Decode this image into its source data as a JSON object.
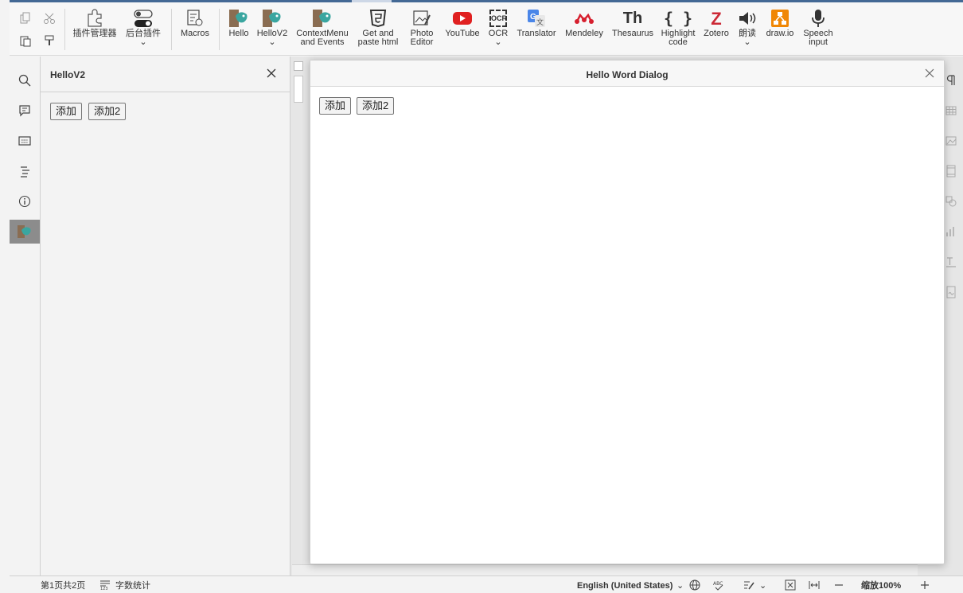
{
  "toolbar": {
    "plugin_manager": "插件管理器",
    "background_plugins": "后台插件",
    "macros": "Macros",
    "hello": "Hello",
    "hellov2": "HelloV2",
    "contextmenu_1": "ContextMenu",
    "contextmenu_2": "and Events",
    "get_paste_1": "Get and",
    "get_paste_2": "paste html",
    "photo_1": "Photo",
    "photo_2": "Editor",
    "youtube": "YouTube",
    "ocr": "OCR",
    "ocr_icon_text": "OCR",
    "translator": "Translator",
    "mendeley": "Mendeley",
    "thesaurus": "Thesaurus",
    "thesaurus_icon_text": "Th",
    "highlight_1": "Highlight",
    "highlight_2": "code",
    "highlight_icon_text": "{ }",
    "zotero": "Zotero",
    "zotero_icon_text": "Z",
    "read_aloud": "朗读",
    "drawio": "draw.io",
    "speech_1": "Speech",
    "speech_2": "input",
    "dropdown_arrow": "⌄"
  },
  "panel": {
    "title": "HelloV2",
    "add_button": "添加",
    "add2_button": "添加2"
  },
  "dialog": {
    "title": "Hello Word Dialog",
    "add_button": "添加",
    "add2_button": "添加2"
  },
  "status": {
    "page_info": "第1页共2页",
    "word_count": "字数统计",
    "language": "English (United States)",
    "zoom": "缩放100%"
  },
  "colors": {
    "accent": "#446995",
    "youtube_red": "#e02020",
    "mendeley_red": "#d61f2e",
    "zotero_red": "#cc2936",
    "drawio_orange": "#f08705"
  }
}
